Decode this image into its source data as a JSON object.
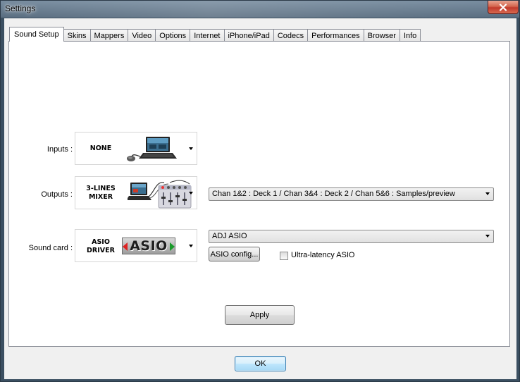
{
  "window": {
    "title": "Settings"
  },
  "tabs": [
    {
      "label": "Sound Setup",
      "active": true
    },
    {
      "label": "Skins"
    },
    {
      "label": "Mappers"
    },
    {
      "label": "Video"
    },
    {
      "label": "Options"
    },
    {
      "label": "Internet"
    },
    {
      "label": "iPhone/iPad"
    },
    {
      "label": "Codecs"
    },
    {
      "label": "Performances"
    },
    {
      "label": "Browser"
    },
    {
      "label": "Info"
    }
  ],
  "sound_setup": {
    "inputs": {
      "label": "Inputs :",
      "value_line1": "NONE",
      "icon": "laptop-mouse"
    },
    "outputs": {
      "label": "Outputs :",
      "value_line1": "3-LINES",
      "value_line2": "MIXER",
      "icon": "laptop-mixer",
      "routing": "Chan 1&2 : Deck 1 / Chan 3&4 : Deck 2 / Chan 5&6 : Samples/preview"
    },
    "soundcard": {
      "label": "Sound card :",
      "value_line1": "ASIO",
      "value_line2": "DRIVER",
      "logo_text": "ASIO",
      "device": "ADJ ASIO",
      "config_button": "ASIO config...",
      "ultra_latency_label": "Ultra-latency ASIO",
      "ultra_latency_checked": false
    },
    "apply_button": "Apply"
  },
  "footer": {
    "ok_button": "OK"
  },
  "colors": {
    "accent": "#3c7fb1",
    "close": "#c0392b"
  }
}
